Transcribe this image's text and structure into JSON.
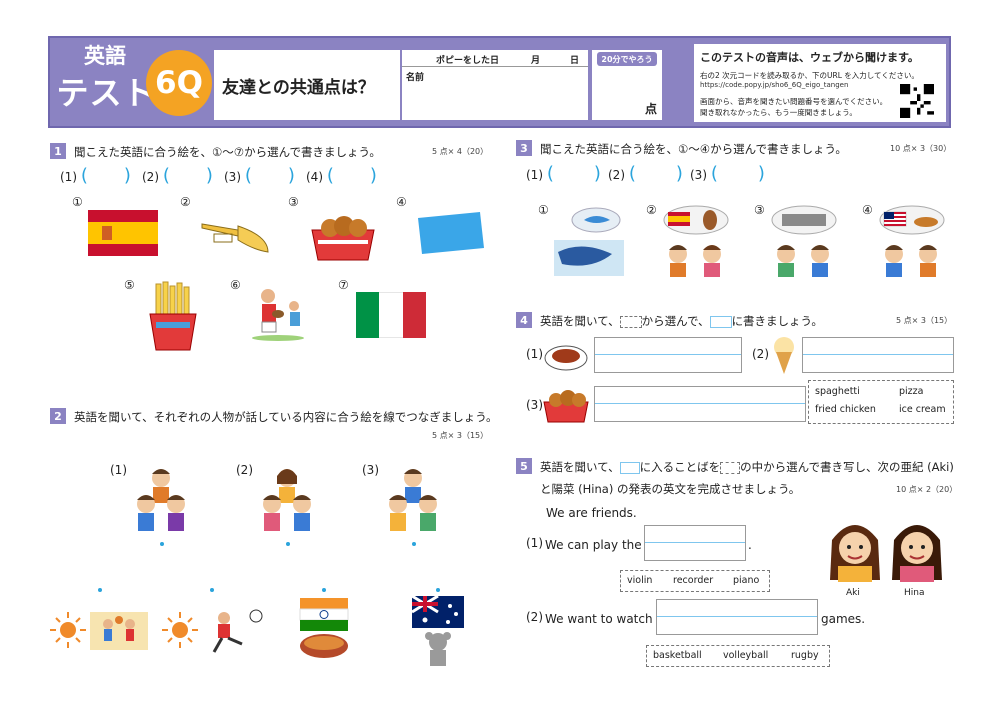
{
  "header": {
    "title_line1": "英語",
    "title_line2": "テスト",
    "badge": "6Q",
    "test_title": "友達との共通点は？",
    "popy_done": "ポピーをした日",
    "month": "月",
    "day": "日",
    "name_label": "名前",
    "time_badge": "20分でやろう",
    "score_unit": "点",
    "info_title": "このテストの音声は、ウェブから聞けます。",
    "info_line1": "右の2 次元コードを読み取るか、下のURL を入力してください。",
    "info_url": "https://code.popy.jp/sho6_6Q_eigo_tangen",
    "info_line2": "画面から、音声を聞きたい問題番号を選んでください。",
    "info_line3": "聞き取れなかったら、もう一度聞きましょう。"
  },
  "s1": {
    "num": "1",
    "instruction": "聞こえた英語に合う絵を、①～⑦から選んで書きましょう。",
    "points": "5 点× 4（20）",
    "answers": [
      "(1)",
      "(2)",
      "(3)",
      "(4)"
    ],
    "paren_open": "(",
    "paren_close": ")",
    "choices": [
      "①",
      "②",
      "③",
      "④",
      "⑤",
      "⑥",
      "⑦"
    ]
  },
  "s2": {
    "num": "2",
    "instruction": "英語を聞いて、それぞれの人物が話している内容に合う絵を線でつなぎましょう。",
    "points": "5 点× 3（15）",
    "people": [
      "(1)",
      "(2)",
      "(3)"
    ]
  },
  "s3": {
    "num": "3",
    "instruction": "聞こえた英語に合う絵を、①～④から選んで書きましょう。",
    "points": "10 点× 3（30）",
    "answers": [
      "(1)",
      "(2)",
      "(3)"
    ],
    "choices": [
      "①",
      "②",
      "③",
      "④"
    ]
  },
  "s4": {
    "num": "4",
    "instruction_a": "英語を聞いて、",
    "instruction_b": "から選んで、",
    "instruction_c": "に書きましょう。",
    "points": "5 点× 3（15）",
    "items": [
      "(1)",
      "(2)",
      "(3)"
    ],
    "words": [
      "spaghetti",
      "pizza",
      "fried chicken",
      "ice cream"
    ]
  },
  "s5": {
    "num": "5",
    "instruction_a": "英語を聞いて、",
    "instruction_b": "に入ることばを",
    "instruction_c": "の中から選んで書き写し、次の亜紀 (Aki)",
    "instruction_d": "と陽菜 (Hina) の発表の英文を完成させましょう。",
    "points": "10 点× 2（20）",
    "intro": "We are friends.",
    "q1_num": "(1)",
    "q1_text": "We can play the",
    "q1_end": ".",
    "q1_words": [
      "violin",
      "recorder",
      "piano"
    ],
    "q2_num": "(2)",
    "q2_text": "We want to watch",
    "q2_end": "games.",
    "q2_words": [
      "basketball",
      "volleyball",
      "rugby"
    ],
    "names": [
      "Aki",
      "Hina"
    ]
  },
  "colors": {
    "accent": "#8b83c2",
    "badge": "#f4a323",
    "line": "#2ba4dc"
  }
}
